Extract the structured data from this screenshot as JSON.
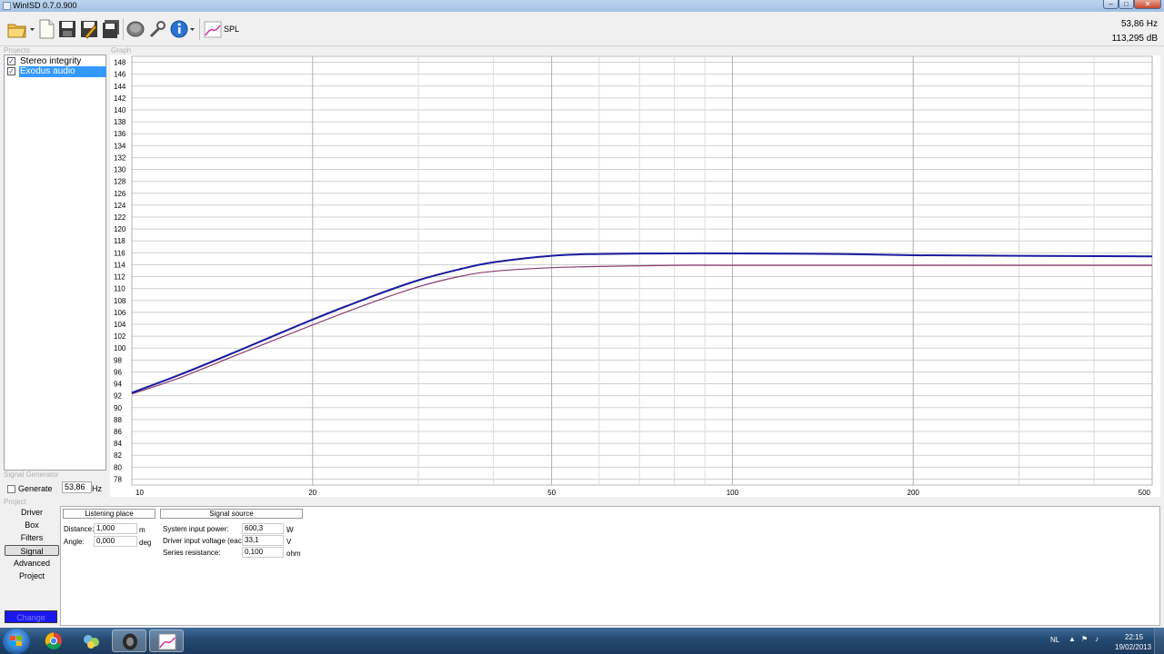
{
  "window": {
    "title": "WinISD 0.7.0.900"
  },
  "toolbar": {
    "spl_label": "SPL",
    "readout_frequency": "53,86 Hz",
    "readout_level": "113,295 dB"
  },
  "sections": {
    "projects": "Projects",
    "graph": "Graph",
    "signal_generator": "Signal Generator",
    "project": "Project"
  },
  "projects": [
    {
      "name": "Stereo integrity",
      "checked": true,
      "selected": false
    },
    {
      "name": "Exodus audio",
      "checked": true,
      "selected": true
    }
  ],
  "signal_generator": {
    "generate_label": "Generate",
    "frequency_value": "53,86",
    "unit": "Hz"
  },
  "nav": {
    "items": [
      "Driver",
      "Box",
      "Filters",
      "Signal",
      "Advanced",
      "Project"
    ],
    "active": "Signal",
    "change_label": "Change"
  },
  "signal_panel": {
    "tab_listening": "Listening place",
    "tab_source": "Signal source",
    "distance_label": "Distance:",
    "distance_value": "1,000",
    "distance_unit": "m",
    "angle_label": "Angle:",
    "angle_value": "0,000",
    "angle_unit": "deg",
    "power_label": "System input power:",
    "power_value": "600,3",
    "power_unit": "W",
    "voltage_label": "Driver input voltage (each):",
    "voltage_value": "33,1",
    "voltage_unit": "V",
    "resistance_label": "Series resistance:",
    "resistance_value": "0,100",
    "resistance_unit": "ohm"
  },
  "taskbar": {
    "language": "NL",
    "time": "22:15",
    "date": "19/02/2013"
  },
  "chart_data": {
    "type": "line",
    "xscale": "log",
    "xlim": [
      10,
      500
    ],
    "ylim": [
      77,
      149
    ],
    "x_ticks": [
      10,
      20,
      50,
      100,
      200,
      500
    ],
    "y_ticks": [
      78,
      80,
      82,
      84,
      86,
      88,
      90,
      92,
      94,
      96,
      98,
      100,
      102,
      104,
      106,
      108,
      110,
      112,
      114,
      116,
      118,
      120,
      122,
      124,
      126,
      128,
      130,
      132,
      134,
      136,
      138,
      140,
      142,
      144,
      146,
      148
    ],
    "grid": true,
    "series": [
      {
        "color": "#1a1aa0",
        "x": [
          10,
          12,
          15,
          20,
          25,
          30,
          35,
          40,
          50,
          60,
          80,
          100,
          150,
          200,
          300,
          500
        ],
        "y": [
          92.5,
          95.5,
          99.5,
          104.8,
          108.6,
          111.4,
          113.2,
          114.4,
          115.5,
          115.8,
          115.9,
          115.9,
          115.8,
          115.6,
          115.5,
          115.4
        ]
      },
      {
        "color": "#8a3a70",
        "x": [
          10,
          12,
          15,
          20,
          25,
          30,
          35,
          40,
          50,
          60,
          80,
          100,
          150,
          200,
          300,
          500
        ],
        "y": [
          92.3,
          95.0,
          98.9,
          103.9,
          107.6,
          110.3,
          112.0,
          112.9,
          113.5,
          113.7,
          113.9,
          113.9,
          113.9,
          113.9,
          113.9,
          113.9
        ]
      }
    ]
  }
}
